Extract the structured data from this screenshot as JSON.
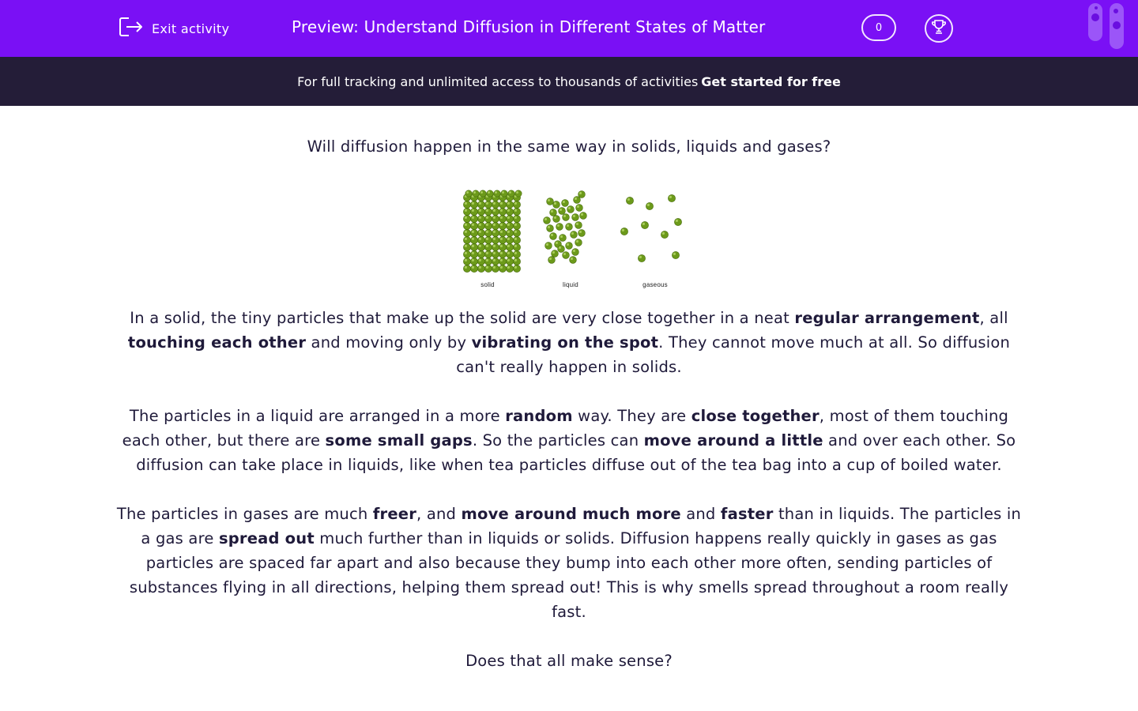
{
  "header": {
    "exit_label": "Exit activity",
    "title": "Preview: Understand Diffusion in Different States of Matter",
    "score": "0"
  },
  "banner": {
    "text": "For full tracking and unlimited access to thousands of activities",
    "cta": "Get started for free"
  },
  "question": "Will diffusion happen in the same way in solids, liquids and gases?",
  "figure": {
    "labels": {
      "solid": "solid",
      "liquid": "liquid",
      "gas": "gaseous"
    },
    "particle_color": "#6c9a1a"
  },
  "p1": {
    "a": "In a solid, the tiny particles that make up the solid are very close together in a neat ",
    "b1": "regular arrangement",
    "c": ", all ",
    "b2": "touching each other",
    "d": " and moving only by ",
    "b3": "vibrating on the spot",
    "e": ". They cannot move much at all. So diffusion can't really happen in solids."
  },
  "p2": {
    "a": "The particles in a liquid are arranged in a more ",
    "b1": "random",
    "c": " way. They are ",
    "b2": "close together",
    "d": ", most of them touching each other, but there are ",
    "b3": "some small gaps",
    "e": ". So the particles can ",
    "b4": "move around a little",
    "f": " and over each other. So diffusion can take place in liquids, like when tea particles diffuse out of the tea bag into a cup of boiled water."
  },
  "p3": {
    "a": "The particles in gases are much ",
    "b1": "freer",
    "c": ", and ",
    "b2": "move around much more",
    "d": " and ",
    "b3": "faster",
    "e": " than in liquids. The particles in a gas are ",
    "b4": "spread out",
    "f": " much further than in liquids or solids. Diffusion happens really quickly in gases as gas particles are spaced far apart and also because they bump into each other more often, sending particles of substances flying in all directions, helping them spread out! This is why smells spread throughout a room really fast."
  },
  "closing": "Does that all make sense?",
  "colors": {
    "brand": "#7a10f5",
    "banner_bg": "#241d38",
    "text": "#1f1a3a"
  }
}
